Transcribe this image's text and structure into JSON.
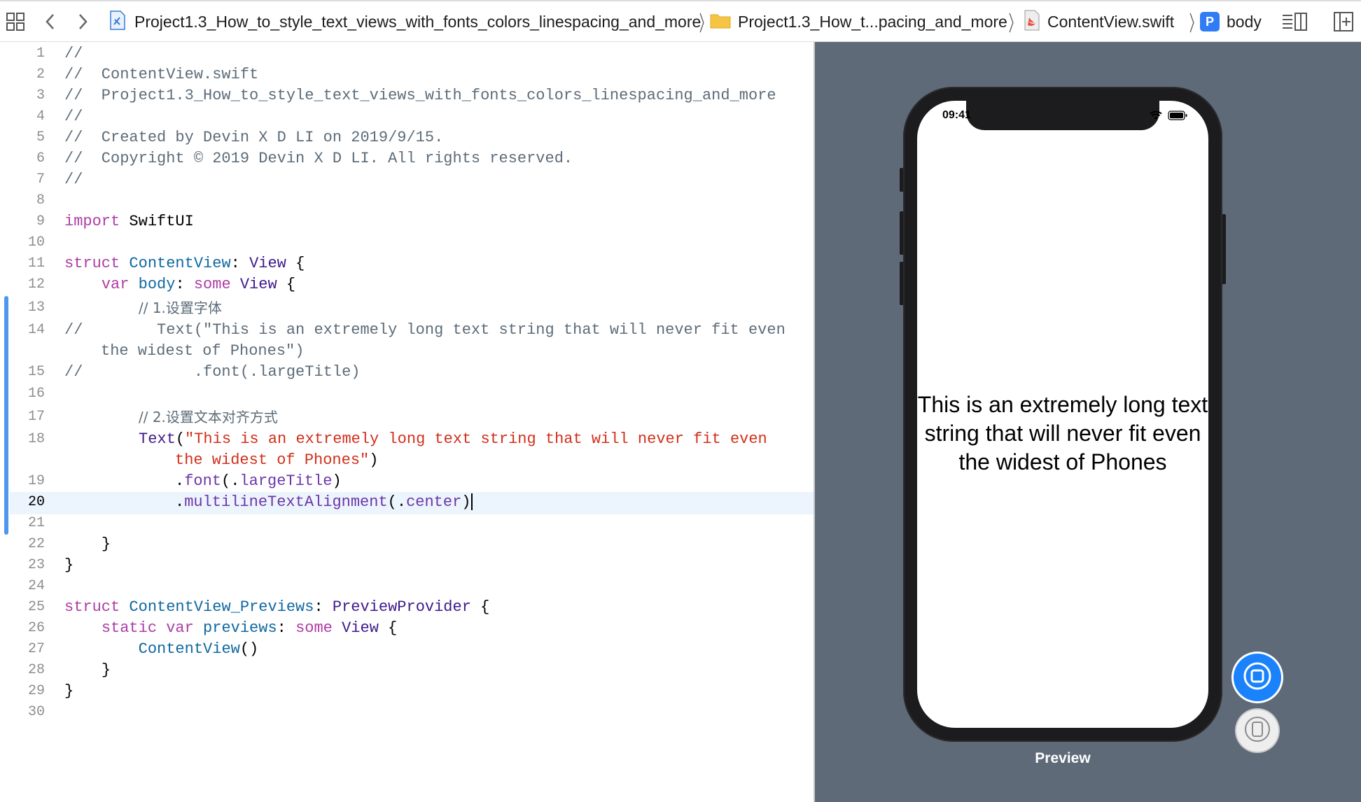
{
  "breadcrumbs": [
    {
      "label": "Project1.3_How_to_style_text_views_with_fonts_colors_linespacing_and_more",
      "icon": "xcode-project-icon"
    },
    {
      "label": "Project1.3_How_t...pacing_and_more",
      "icon": "folder-icon"
    },
    {
      "label": "ContentView.swift",
      "icon": "swift-file-icon"
    },
    {
      "label": "body",
      "icon": "property-icon",
      "badge": "P"
    }
  ],
  "editor": {
    "active_line": 20,
    "line_numbers": [
      "1",
      "2",
      "3",
      "4",
      "5",
      "6",
      "7",
      "8",
      "9",
      "10",
      "11",
      "12",
      "13",
      "14",
      "",
      "15",
      "16",
      "17",
      "18",
      "",
      "19",
      "20",
      "21",
      "22",
      "23",
      "24",
      "25",
      "26",
      "27",
      "28",
      "29",
      "30"
    ],
    "code": {
      "l1": "//",
      "l2": "//  ContentView.swift",
      "l3": "//  Project1.3_How_to_style_text_views_with_fonts_colors_linespacing_and_more",
      "l4": "//",
      "l5": "//  Created by Devin X D LI on 2019/9/15.",
      "l6": "//  Copyright © 2019 Devin X D LI. All rights reserved.",
      "l7": "//",
      "kw_import": "import",
      "mod_swiftui": "SwiftUI",
      "kw_struct": "struct",
      "name_contentview": "ContentView",
      "colon": ":",
      "ty_view": "View",
      "brace_open": "{",
      "brace_close": "}",
      "kw_var": "var",
      "name_body": "body",
      "kw_some": "some",
      "cm_13": "// 1.设置字体",
      "cm_14a": "//        Text(\"This is an extremely long text string that will never fit even",
      "cm_14b": "the widest of Phones\")",
      "cm_15": "//            .font(.largeTitle)",
      "cm_17": "// 2.设置文本对齐方式",
      "ty_text": "Text",
      "paren_open": "(",
      "paren_close": ")",
      "str_18a": "\"This is an extremely long text string that will never fit even",
      "str_18b": "the widest of Phones\"",
      "dot": ".",
      "fn_font": "font",
      "fn_large_title": "largeTitle",
      "fn_mta": "multilineTextAlignment",
      "fn_center": "center",
      "name_previews_struct": "ContentView_Previews",
      "ty_preview_provider": "PreviewProvider",
      "kw_static": "static",
      "name_previews": "previews",
      "call_contentview": "ContentView",
      "parens": "()"
    }
  },
  "preview": {
    "status_time": "09:41",
    "text": "This is an extremely long text string that will never fit even the widest of Phones",
    "label": "Preview"
  },
  "colors": {
    "accent": "#1a82fb",
    "comment": "#5d6c79",
    "keyword": "#ad3da4",
    "type": "#3e1a8c",
    "declaration": "#0f68a0",
    "function": "#6c36a9",
    "string": "#d12f1b",
    "canvas": "#5f6a78"
  }
}
